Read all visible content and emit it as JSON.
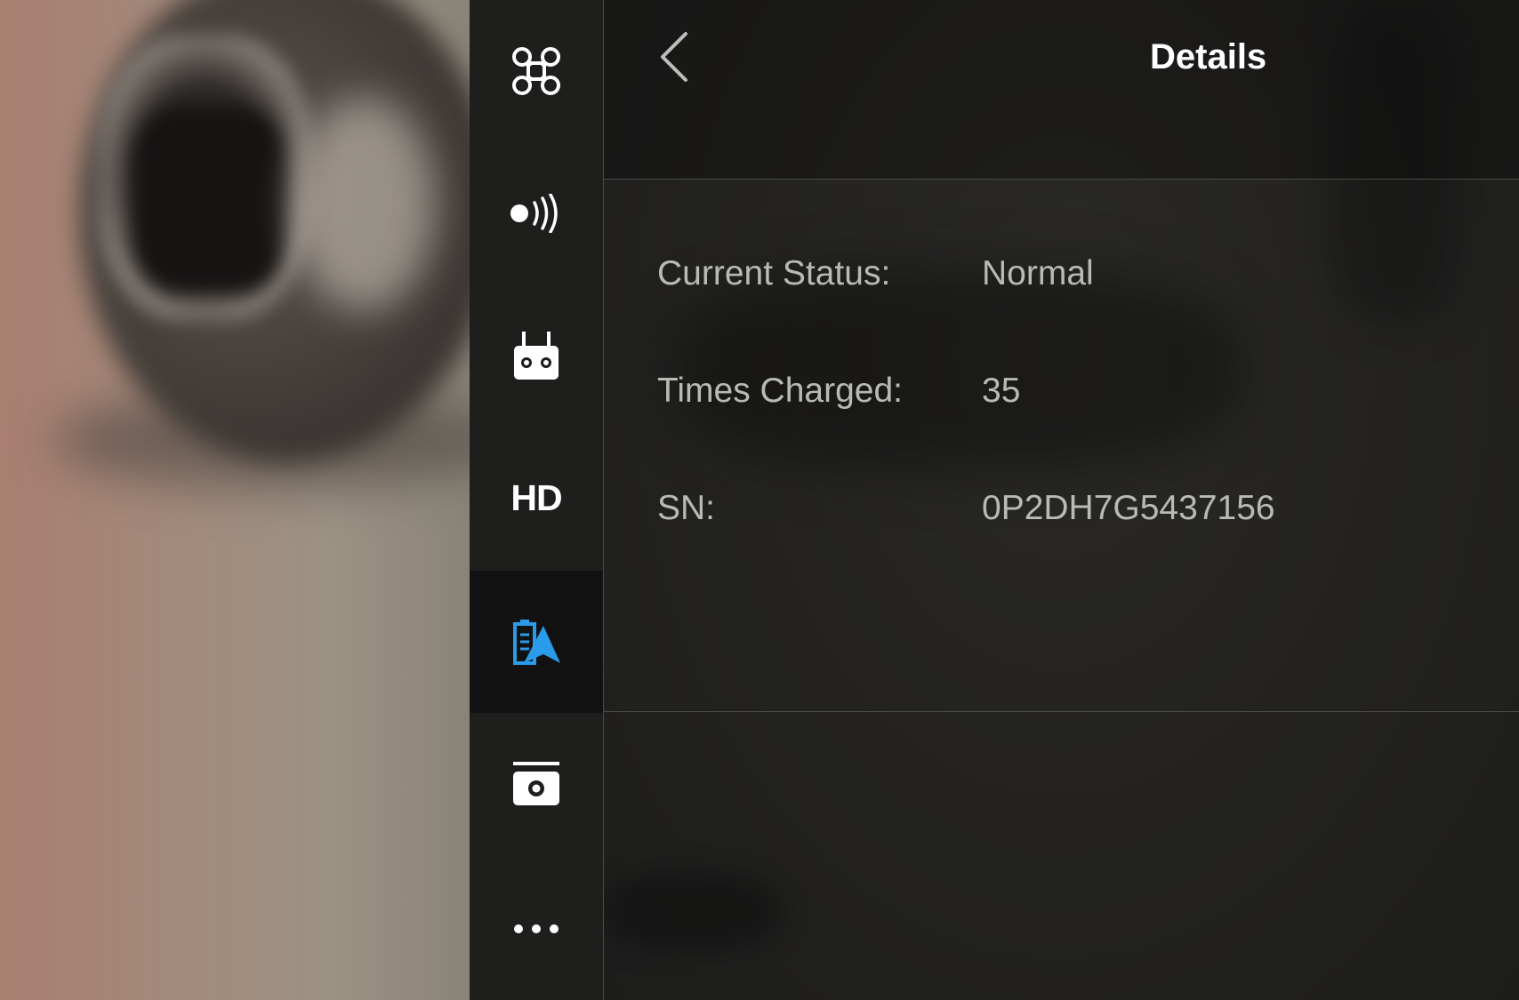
{
  "sidebar": {
    "items": [
      {
        "name": "aircraft-settings",
        "icon": "drone-icon"
      },
      {
        "name": "signal-settings",
        "icon": "signal-icon"
      },
      {
        "name": "remote-controller-settings",
        "icon": "remote-controller-icon"
      },
      {
        "name": "hd-transmission",
        "icon": "hd-text-icon",
        "label": "HD"
      },
      {
        "name": "battery-settings",
        "icon": "battery-icon",
        "active": true
      },
      {
        "name": "camera-settings",
        "icon": "camera-icon"
      },
      {
        "name": "more-settings",
        "icon": "more-icon"
      }
    ],
    "active_color": "#2a9be8"
  },
  "header": {
    "title": "Details",
    "back_icon": "chevron-left-icon"
  },
  "details": [
    {
      "label": "Current Status:",
      "value": "Normal"
    },
    {
      "label": "Times Charged:",
      "value": "35"
    },
    {
      "label": "SN:",
      "value": "0P2DH7G5437156"
    }
  ]
}
